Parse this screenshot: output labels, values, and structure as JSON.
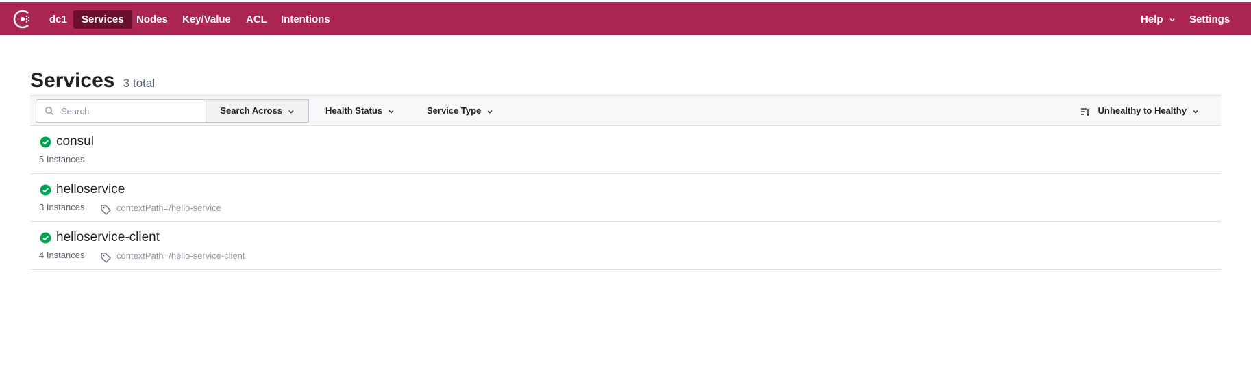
{
  "nav": {
    "datacenter": "dc1",
    "items": [
      {
        "label": "Services",
        "active": true
      },
      {
        "label": "Nodes",
        "active": false
      },
      {
        "label": "Key/Value",
        "active": false
      },
      {
        "label": "ACL",
        "active": false
      },
      {
        "label": "Intentions",
        "active": false
      }
    ],
    "help_label": "Help",
    "settings_label": "Settings",
    "brand_color": "#ac2453",
    "active_color": "#6b0f2f"
  },
  "page": {
    "title": "Services",
    "count": "3 total"
  },
  "filters": {
    "search_placeholder": "Search",
    "search_value": "",
    "search_across_label": "Search Across",
    "health_status_label": "Health Status",
    "service_type_label": "Service Type",
    "sort_label": "Unhealthy to Healthy"
  },
  "services": [
    {
      "name": "consul",
      "instances": "5 Instances",
      "tag": "",
      "status": "passing"
    },
    {
      "name": "helloservice",
      "instances": "3 Instances",
      "tag": "contextPath=/hello-service",
      "status": "passing"
    },
    {
      "name": "helloservice-client",
      "instances": "4 Instances",
      "tag": "contextPath=/hello-service-client",
      "status": "passing"
    }
  ],
  "colors": {
    "passing": "#00a34f"
  },
  "icons": {
    "logo": "consul-logo-icon",
    "search": "search-icon",
    "status": "check-circle-icon",
    "tag": "tag-icon",
    "sort": "sort-icon",
    "chevron": "chevron-down-icon"
  }
}
